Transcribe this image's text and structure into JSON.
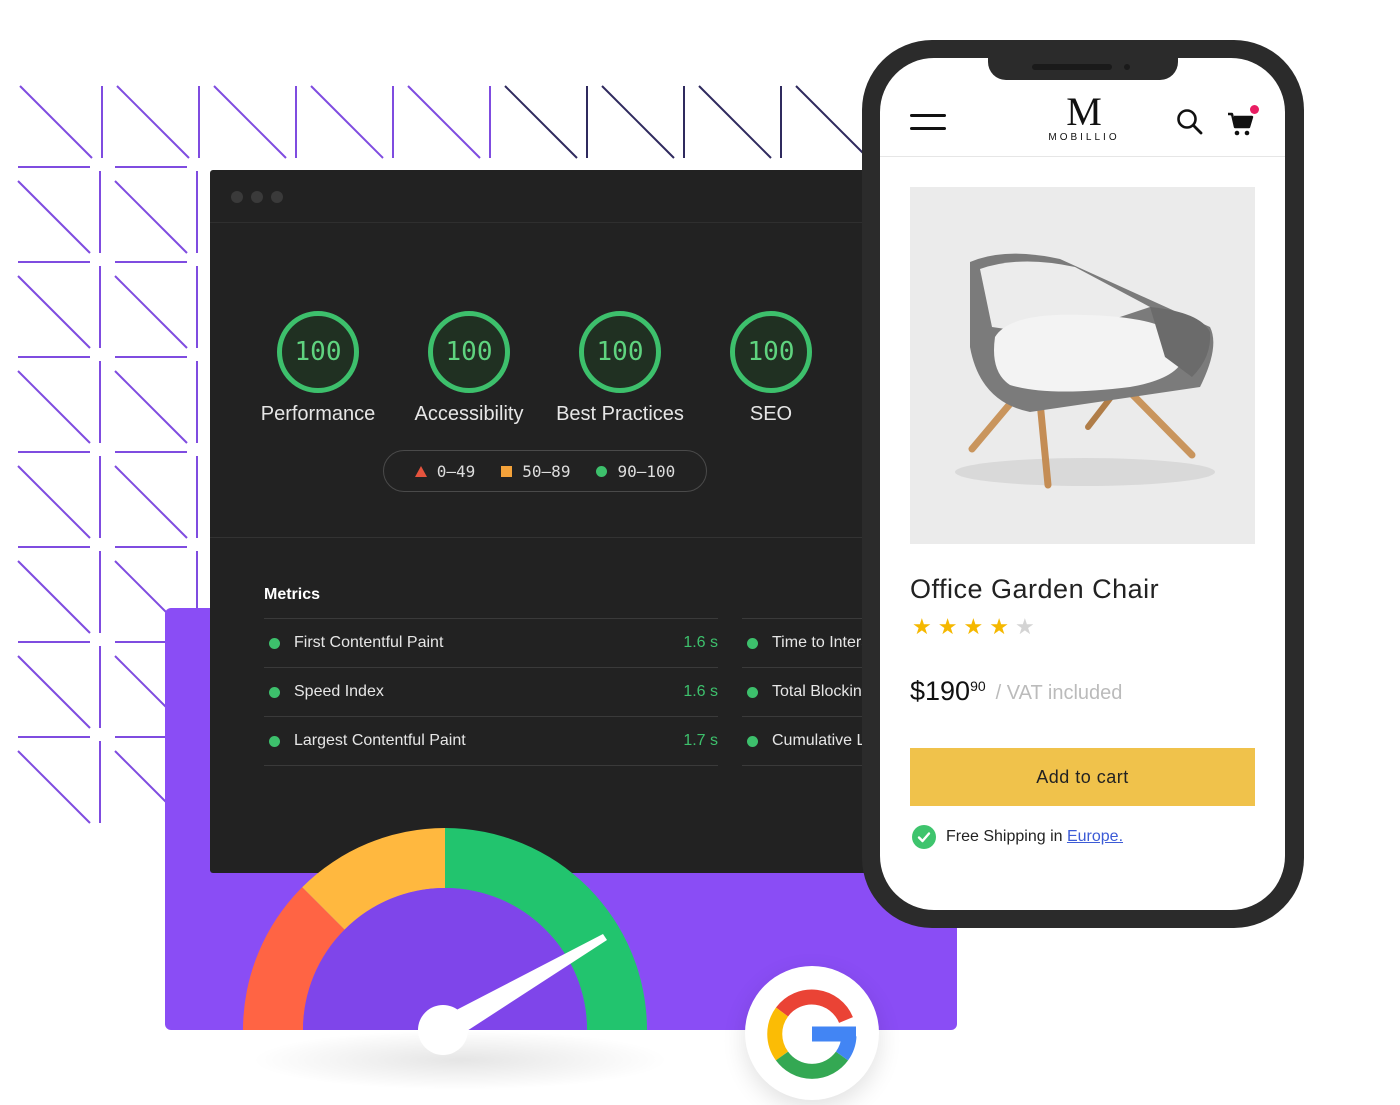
{
  "lighthouse": {
    "scores": [
      {
        "value": "100",
        "label": "Performance"
      },
      {
        "value": "100",
        "label": "Accessibility"
      },
      {
        "value": "100",
        "label": "Best Practices"
      },
      {
        "value": "100",
        "label": "SEO"
      }
    ],
    "legend": [
      {
        "range": "0–49",
        "symbol": "red-triangle-icon",
        "color": "#e5533d"
      },
      {
        "range": "50–89",
        "symbol": "orange-square-icon",
        "color": "#f4a23a"
      },
      {
        "range": "90–100",
        "symbol": "green-circle-icon",
        "color": "#3dc06c"
      }
    ],
    "metrics_title": "Metrics",
    "metrics_left": [
      {
        "name": "First Contentful Paint",
        "value": "1.6 s"
      },
      {
        "name": "Speed Index",
        "value": "1.6 s"
      },
      {
        "name": "Largest Contentful Paint",
        "value": "1.7 s"
      }
    ],
    "metrics_right": [
      {
        "name": "Time to Interactive"
      },
      {
        "name": "Total Blocking Time"
      },
      {
        "name": "Cumulative Layout Shift"
      }
    ]
  },
  "store": {
    "logo_letter": "M",
    "logo_name": "MOBILLIO",
    "product": {
      "title": "Office Garden Chair",
      "rating": 4,
      "rating_max": 5,
      "price_main": "$190",
      "price_cents": "90",
      "price_note": "/ VAT included",
      "add_to_cart": "Add to cart",
      "shipping_text": "Free Shipping in",
      "shipping_link": "Europe."
    }
  },
  "colors": {
    "accent_purple": "#8a4df5",
    "score_green": "#3dc06c",
    "button_yellow": "#f0c24b",
    "gauge": [
      "#ff6444",
      "#ffb83f",
      "#22c46e"
    ]
  },
  "icons": {
    "menu": "hamburger-menu-icon",
    "search": "search-icon",
    "cart": "cart-icon",
    "shipping": "check-circle-icon",
    "brand": "google-g-icon"
  }
}
